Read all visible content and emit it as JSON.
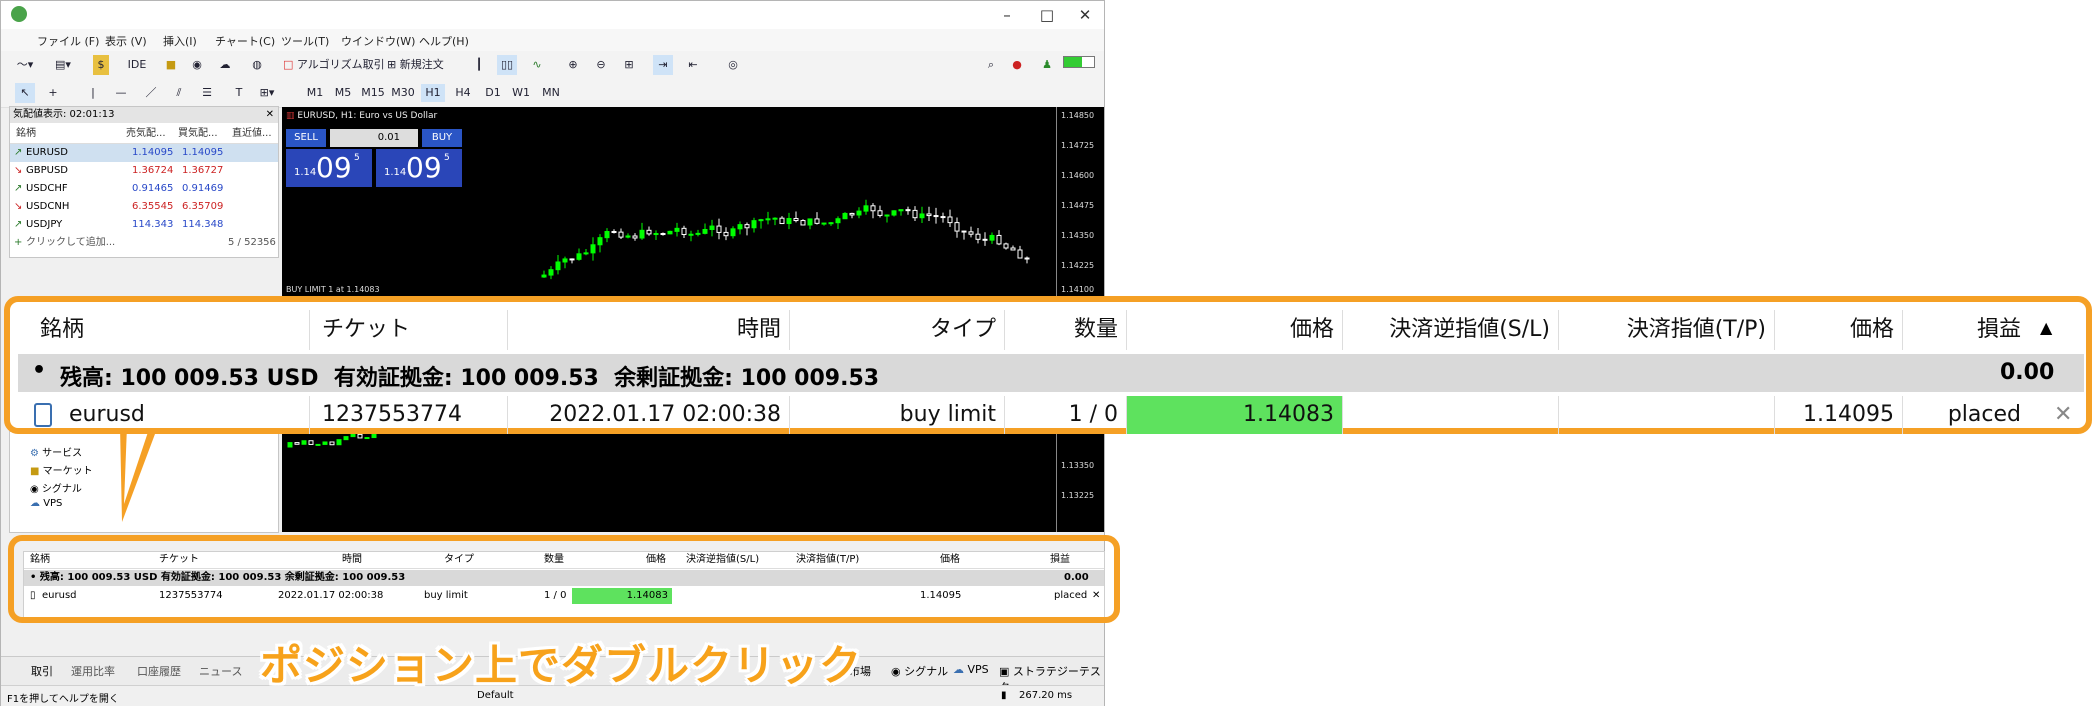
{
  "menu": [
    "ファイル (F)",
    "表示 (V)",
    "挿入(I)",
    "チャート(C)",
    "ツール(T)",
    "ウインドウ(W)",
    "ヘルプ(H)"
  ],
  "toolbar": {
    "ide_label": "IDE",
    "algo_label": "アルゴリズム取引",
    "new_order_label": "新規注文",
    "timeframes": [
      "M1",
      "M5",
      "M15",
      "M30",
      "H1",
      "H4",
      "D1",
      "W1",
      "MN"
    ],
    "active_timeframe": "H1"
  },
  "market_watch": {
    "title": "気配値表示: 02:01:13",
    "headers": [
      "銘柄",
      "売気配...",
      "買気配...",
      "直近値..."
    ],
    "rows": [
      {
        "symbol": "EURUSD",
        "bid": "1.14095",
        "ask": "1.14095",
        "dir": "up"
      },
      {
        "symbol": "GBPUSD",
        "bid": "1.36724",
        "ask": "1.36727",
        "dir": "down"
      },
      {
        "symbol": "USDCHF",
        "bid": "0.91465",
        "ask": "0.91469",
        "dir": "up"
      },
      {
        "symbol": "USDCNH",
        "bid": "6.35545",
        "ask": "6.35709",
        "dir": "down"
      },
      {
        "symbol": "USDJPY",
        "bid": "114.343",
        "ask": "114.348",
        "dir": "up"
      }
    ],
    "add_label": "クリックして追加...",
    "count": "5 / 52356"
  },
  "navigator": {
    "items": [
      "サービス",
      "マーケット",
      "シグナル",
      "VPS"
    ]
  },
  "chart": {
    "title": "EURUSD, H1: Euro vs US Dollar",
    "sell_label": "SELL",
    "buy_label": "BUY",
    "lot": "0.01",
    "sell_price_small": "1.14",
    "sell_price_big": "09",
    "sell_price_sup": "5",
    "buy_price_small": "1.14",
    "buy_price_big": "09",
    "buy_price_sup": "5",
    "order_line_label": "BUY LIMIT 1 at 1.14083",
    "price_labels_top": [
      "1.14850",
      "1.14725",
      "1.14600",
      "1.14475",
      "1.14350",
      "1.14225",
      "1.14100"
    ],
    "price_labels_bottom": [
      "1.13350",
      "1.13225"
    ],
    "bg_color": "#000000",
    "up_color": "#00ff00",
    "down_color": "#ffffff"
  },
  "trade_table": {
    "headers": [
      "銘柄",
      "チケット",
      "時間",
      "タイプ",
      "数量",
      "価格",
      "決済逆指値(S/L)",
      "決済指値(T/P)",
      "価格",
      "損益"
    ],
    "balance_line": "残高: 100 009.53 USD  有効証拠金: 100 009.53  余剰証拠金: 100 009.53",
    "balance_pnl": "0.00",
    "order": {
      "symbol": "eurusd",
      "ticket": "1237553774",
      "time": "2022.01.17 02:00:38",
      "type": "buy limit",
      "volume": "1 / 0",
      "price": "1.14083",
      "sl": "",
      "tp": "",
      "current_price": "1.14095",
      "status": "placed"
    },
    "highlight_color": "#5ee25e"
  },
  "bottom_tabs": [
    "取引",
    "運用比率",
    "口座履歴",
    "ニュース",
    "市場",
    "シグナル",
    "VPS",
    "ストラテジーテスター"
  ],
  "status_bar": {
    "help": "F1を押してヘルプを開く",
    "profile": "Default",
    "ping": "267.20 ms"
  },
  "caption": "ポジション上でダブルクリック",
  "accent_color": "#f5a025"
}
